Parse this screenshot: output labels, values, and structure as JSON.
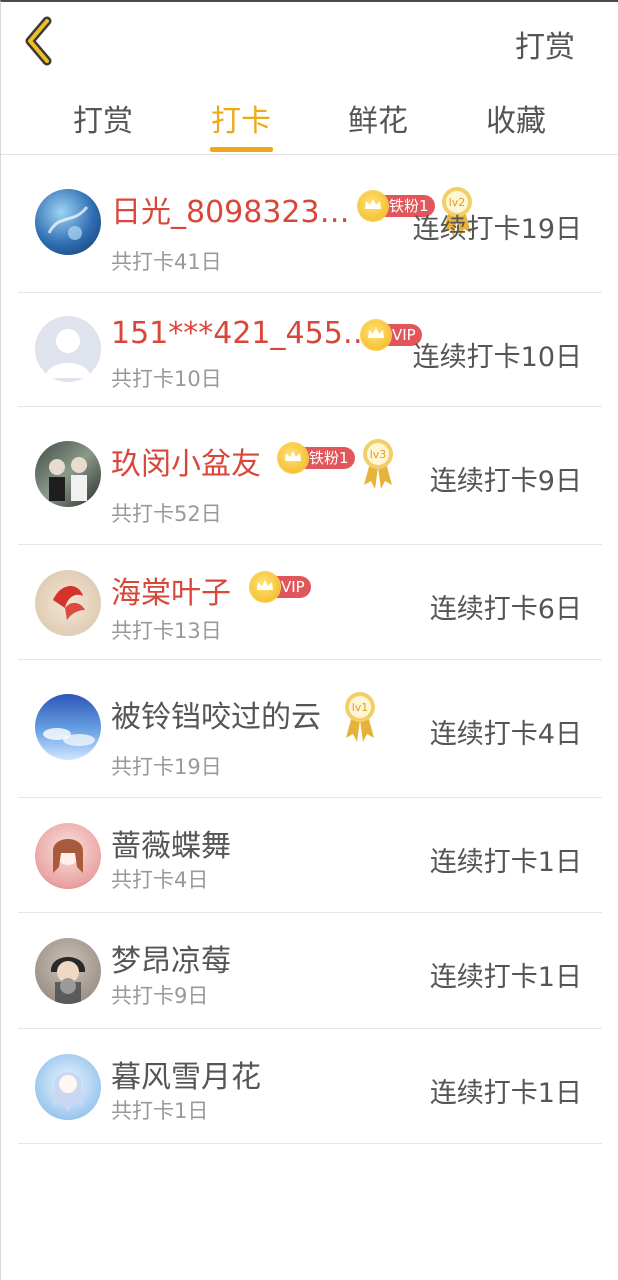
{
  "top_bar": {
    "title": "打赏"
  },
  "tabs": [
    {
      "label": "打赏",
      "active": false
    },
    {
      "label": "打卡",
      "active": true
    },
    {
      "label": "鲜花",
      "active": false
    },
    {
      "label": "收藏",
      "active": false
    }
  ],
  "accent_color": "#f0a818",
  "name_red_color": "#d9473a",
  "rows": [
    {
      "name": "日光_8098323…",
      "badge": "铁粉1",
      "level": "lv2",
      "total": "共打卡41日",
      "streak": "连续打卡19日"
    },
    {
      "name": "151***421_455…",
      "badge": "VIP",
      "total": "共打卡10日",
      "streak": "连续打卡10日"
    },
    {
      "name": "玖闵小盆友",
      "badge": "铁粉1",
      "level": "lv3",
      "total": "共打卡52日",
      "streak": "连续打卡9日"
    },
    {
      "name": "海棠叶子",
      "badge": "VIP",
      "total": "共打卡13日",
      "streak": "连续打卡6日"
    },
    {
      "name": "被铃铛咬过的云",
      "level": "lv1",
      "total": "共打卡19日",
      "streak": "连续打卡4日"
    },
    {
      "name": "蔷薇蝶舞",
      "total": "共打卡4日",
      "streak": "连续打卡1日"
    },
    {
      "name": "梦昂凉莓",
      "total": "共打卡9日",
      "streak": "连续打卡1日"
    },
    {
      "name": "暮风雪月花",
      "total": "共打卡1日",
      "streak": "连续打卡1日"
    }
  ]
}
